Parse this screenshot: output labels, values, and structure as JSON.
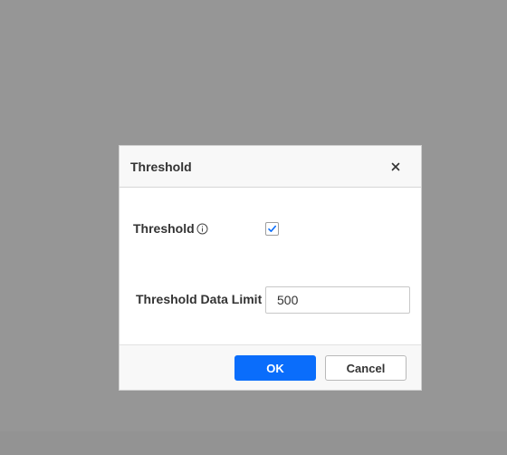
{
  "dialog": {
    "title": "Threshold",
    "close_icon": "close-icon"
  },
  "fields": {
    "threshold_label": "Threshold",
    "threshold_info_icon": "info-icon",
    "threshold_checked": true,
    "limit_label": "Threshold Data Limit",
    "limit_value": "500"
  },
  "footer": {
    "ok_label": "OK",
    "cancel_label": "Cancel"
  },
  "colors": {
    "overlay": "#969696",
    "primary": "#0a6dfb",
    "check": "#0a6dfb"
  }
}
